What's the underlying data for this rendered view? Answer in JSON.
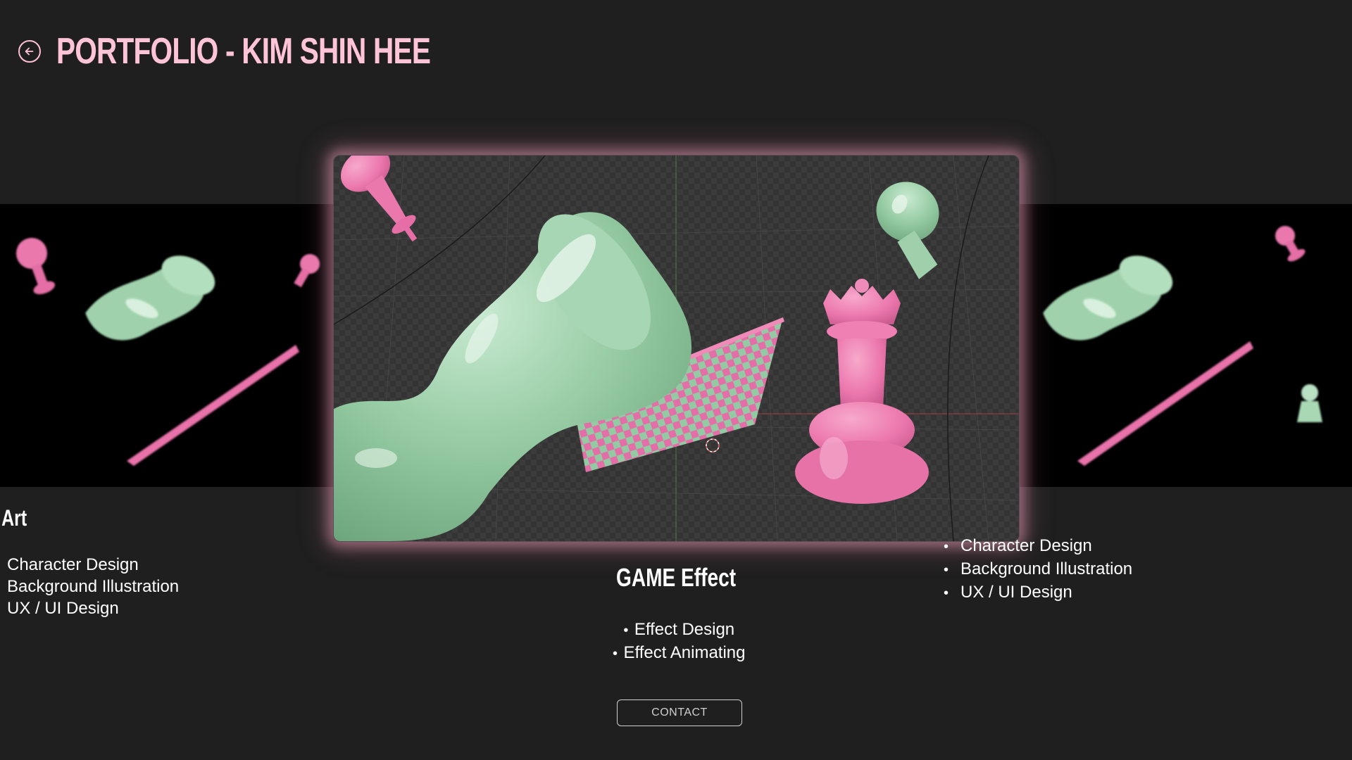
{
  "header": {
    "title": "PORTFOLIO - KIM SHIN HEE",
    "back_icon": "arrow-left-circle-icon"
  },
  "colors": {
    "background": "#1f1f1f",
    "accent_pink": "#ffc4d8",
    "piece_pink": "#ee7fb2",
    "piece_green": "#9ccfaa"
  },
  "carousel": {
    "prev_slide": {
      "title": "me Art",
      "items": [
        "Character Design",
        "Background Illustration",
        "UX / UI Design"
      ]
    },
    "current_slide": {
      "title": "GAME Effect",
      "items": [
        "Effect Design",
        "Effect Animating"
      ]
    },
    "next_slide": {
      "items": [
        "Character Design",
        "Background Illustration",
        "UX / UI Design"
      ]
    }
  },
  "contact_button": {
    "label": "CONTACT"
  }
}
